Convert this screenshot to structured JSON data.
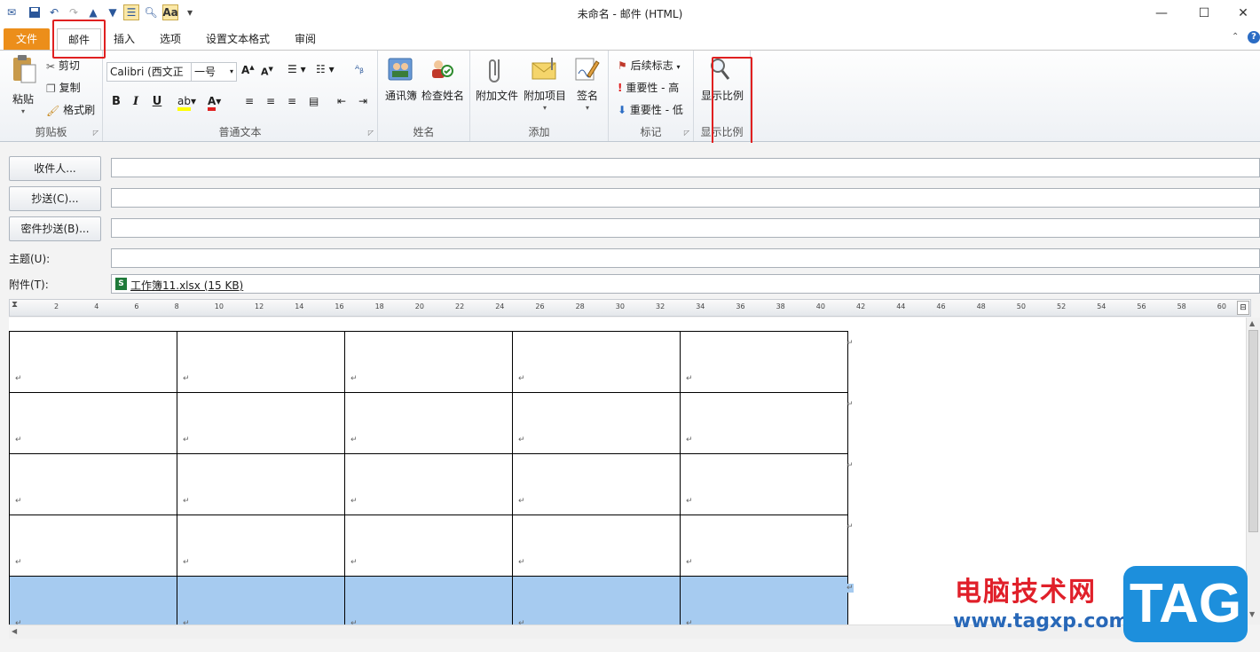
{
  "window": {
    "title": "未命名 - 邮件 (HTML)"
  },
  "tabs": [
    "文件",
    "邮件",
    "插入",
    "选项",
    "设置文本格式",
    "审阅"
  ],
  "ribbon": {
    "clipboard": {
      "label": "剪贴板",
      "paste": "粘贴",
      "cut": "剪切",
      "copy": "复制",
      "painter": "格式刷"
    },
    "basic_text": {
      "label": "普通文本",
      "font": "Calibri (西文正",
      "size": "一号",
      "bold": "B",
      "italic": "I",
      "underline": "U"
    },
    "names": {
      "label": "姓名",
      "address_book": "通讯簿",
      "check_names": "检查姓名"
    },
    "include": {
      "label": "添加",
      "attach_file": "附加文件",
      "attach_item": "附加项目",
      "signature": "签名"
    },
    "tags": {
      "label": "标记",
      "follow_up": "后续标志",
      "high": "重要性 - 高",
      "low": "重要性 - 低"
    },
    "zoom": {
      "label": "显示比例",
      "zoom_btn": "显示比例"
    }
  },
  "header": {
    "to": "收件人...",
    "cc": "抄送(C)...",
    "bcc": "密件抄送(B)...",
    "subject_label": "主题(U):",
    "attach_label": "附件(T):",
    "attachment": "工作簿11.xlsx (15 KB)"
  },
  "ruler": [
    "2",
    "4",
    "6",
    "8",
    "10",
    "12",
    "14",
    "16",
    "18",
    "20",
    "22",
    "24",
    "26",
    "28",
    "30",
    "32",
    "34",
    "36",
    "38",
    "40",
    "42",
    "44",
    "46",
    "48",
    "50",
    "52",
    "54",
    "56",
    "58",
    "60"
  ],
  "table": {
    "rows": 5,
    "cols": 5,
    "mark": "↵"
  },
  "watermark": {
    "cn": "电脑技术网",
    "url": "www.tagxp.com",
    "tag": "TAG"
  },
  "colors": {
    "file_tab": "#ec8e1a",
    "selection": "#a6cbf0",
    "highlight": "#e02020"
  }
}
